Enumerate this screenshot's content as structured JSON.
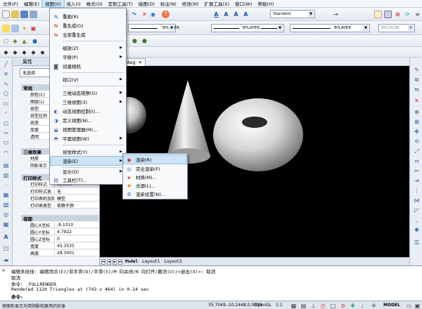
{
  "menubar": {
    "items": [
      "文件(F)",
      "编辑(E)",
      "视图(V)",
      "插入(I)",
      "格式(O)",
      "定制工具(T)",
      "绘图(D)",
      "标注(N)",
      "修改(M)",
      "扩展工具(X)",
      "窗口(W)",
      "帮助(H)"
    ],
    "active_index": 2
  },
  "toolbar": {
    "text_style": "Standard",
    "layer_value": "0",
    "linetype_1": "BYLAYER",
    "linetype_2": "BYLAYER",
    "linetype_3": "BYLAYER",
    "color": "BYCOLOR"
  },
  "properties": {
    "title": "属性",
    "selection": "无选择",
    "sections": {
      "general": "常规",
      "threed": "三维效果",
      "print": "打印样式",
      "view": "视图"
    },
    "general_rows": [
      {
        "key": "颜色(C)",
        "value": ""
      },
      {
        "key": "图层(L)",
        "value": ""
      },
      {
        "key": "线型",
        "value": ""
      },
      {
        "key": "线型比例",
        "value": ""
      },
      {
        "key": "线宽",
        "value": ""
      },
      {
        "key": "厚度",
        "value": ""
      },
      {
        "key": "透明",
        "value": ""
      }
    ],
    "threed_rows": [
      {
        "key": "材质",
        "value": ""
      },
      {
        "key": "阴影显示",
        "value": ""
      }
    ],
    "print_rows": [
      {
        "key": "打印样式",
        "value": "ByColor"
      },
      {
        "key": "打印样式表",
        "value": "无"
      },
      {
        "key": "打印表附加到",
        "value": "模型"
      },
      {
        "key": "打印表类型",
        "value": "依赖于颜"
      }
    ],
    "view_rows": [
      {
        "key": "圆心X坐标",
        "value": "-8.1010"
      },
      {
        "key": "圆心Y坐标",
        "value": "4.7922"
      },
      {
        "key": "圆心Z坐标",
        "value": "0"
      },
      {
        "key": "宽度",
        "value": "45.3535"
      },
      {
        "key": "高度",
        "value": "28.3001"
      }
    ]
  },
  "document": {
    "tab_label": "dwg"
  },
  "layout_tabs": [
    "Model",
    "Layout1",
    "Layout2"
  ],
  "view_menu": {
    "items": [
      {
        "label": "重画(R)",
        "icon": "redraw-icon",
        "sub": false
      },
      {
        "label": "重生成(G)",
        "icon": "regen-icon",
        "sub": false
      },
      {
        "label": "全部重生成",
        "icon": "regen-all-icon",
        "sub": false
      },
      {
        "label": "缩放(Z)",
        "icon": "",
        "sub": true
      },
      {
        "label": "平移(P)",
        "icon": "",
        "sub": true
      },
      {
        "label": "创建相机",
        "icon": "camera-icon",
        "sub": false
      },
      {
        "label": "视口(V)",
        "icon": "",
        "sub": true
      },
      {
        "label": "三维动态观察(O)",
        "icon": "",
        "sub": true
      },
      {
        "label": "三维视图(3)",
        "icon": "",
        "sub": true
      },
      {
        "label": "动态视图控制(I)...",
        "icon": "dynamic-view-icon",
        "sub": false
      },
      {
        "label": "定义视图(N)...",
        "icon": "named-view-icon",
        "sub": false
      },
      {
        "label": "视图管理器(M)...",
        "icon": "view-manager-icon",
        "sub": false
      },
      {
        "label": "平面视图(W)",
        "icon": "plan-view-icon",
        "sub": true
      },
      {
        "label": "视觉样式(Y)",
        "icon": "",
        "sub": true
      },
      {
        "label": "渲染(E)",
        "icon": "",
        "sub": true
      },
      {
        "label": "显示(D)",
        "icon": "",
        "sub": true
      },
      {
        "label": "工具栏(T)...",
        "icon": "toolbar-icon",
        "sub": false
      }
    ],
    "highlighted_index": 14
  },
  "render_menu": {
    "items": [
      {
        "label": "渲染(R)",
        "icon": "render-icon"
      },
      {
        "label": "完全渲染(F)",
        "icon": "full-render-icon"
      },
      {
        "label": "材质(M)...",
        "icon": "material-icon"
      },
      {
        "label": "光源(L)...",
        "icon": "light-icon"
      },
      {
        "label": "渲染设置(N)...",
        "icon": "render-settings-icon"
      }
    ],
    "highlighted_index": 0
  },
  "command": {
    "lines": [
      "编辑多段线: 编辑顶点(E)/非平滑(D)/平滑(S)/M 向关闭/N 向打开/撤消(U)/<退出(X)>: 取消",
      "取消",
      "命令: _FULLRENDER",
      "Rendered 1120 Triangles at (743 x 464) in 0.14 sec"
    ],
    "prompt": "命令:"
  },
  "status": {
    "message": "将图形显示为带阴影和离亮的实体",
    "coords": "35.7049,-10.2448,0.0000",
    "opengl": "OpenGL",
    "scale": "1:1",
    "model": "MODEL"
  },
  "colors": {
    "menu_highlight": "#cde4f7",
    "canvas_bg": "#000000"
  }
}
